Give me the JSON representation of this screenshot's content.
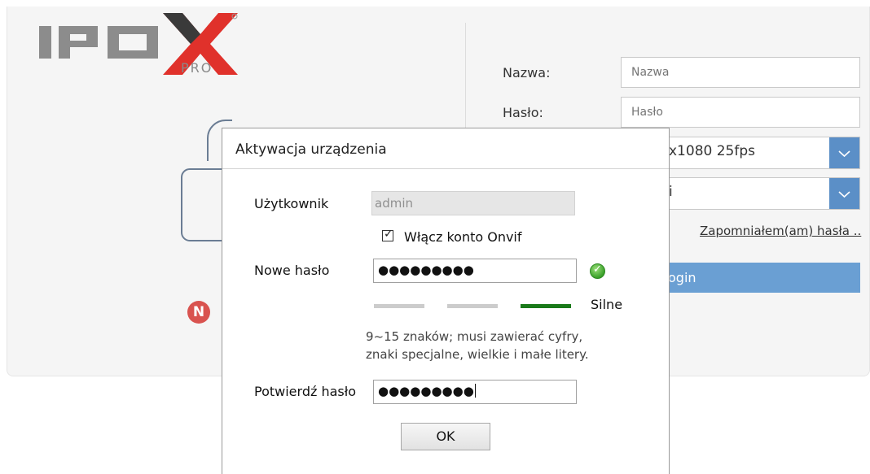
{
  "brand": {
    "logo_text": "IPOX",
    "logo_sub": "PRO",
    "logo_colors": {
      "gray": "#8c8c8c",
      "dark": "#3a3a3a",
      "red": "#e0312b"
    }
  },
  "login": {
    "name_label": "Nazwa:",
    "name_placeholder": "Nazwa",
    "password_label": "Hasło:",
    "password_placeholder": "Hasło",
    "stream_value": "x1080 25fps",
    "language_value": "i",
    "forgot_link": "Zapomniałem(am) hasła ..",
    "login_button": "Login",
    "login_button_visible": "ogin",
    "n_badge": "N"
  },
  "dialog": {
    "title": "Aktywacja urządzenia",
    "user_label": "Użytkownik",
    "user_value": "admin",
    "onvif_label": "Włącz konto Onvif",
    "onvif_checked": true,
    "new_password_label": "Nowe hasło",
    "new_password_mask": "●●●●●●●●●",
    "strength_label": "Silne",
    "strength_level": 3,
    "strength_max": 3,
    "hint_line1": "9~15 znaków; musi zawierać cyfry,",
    "hint_line2": "znaki specjalne, wielkie i małe litery.",
    "confirm_label": "Potwierdź hasło",
    "confirm_mask": "●●●●●●●●●",
    "ok_button": "OK"
  },
  "icons": {
    "lock": "lock-icon",
    "valid": "check-circle-icon",
    "dropdown": "chevron-down-icon",
    "badge": "n-badge-icon"
  },
  "colors": {
    "accent_blue": "#5b8fc7",
    "login_blue": "#6a9fd3",
    "strength_strong": "#1a7a1a",
    "strength_inactive": "#cccccc",
    "badge_red": "#d9534f"
  }
}
